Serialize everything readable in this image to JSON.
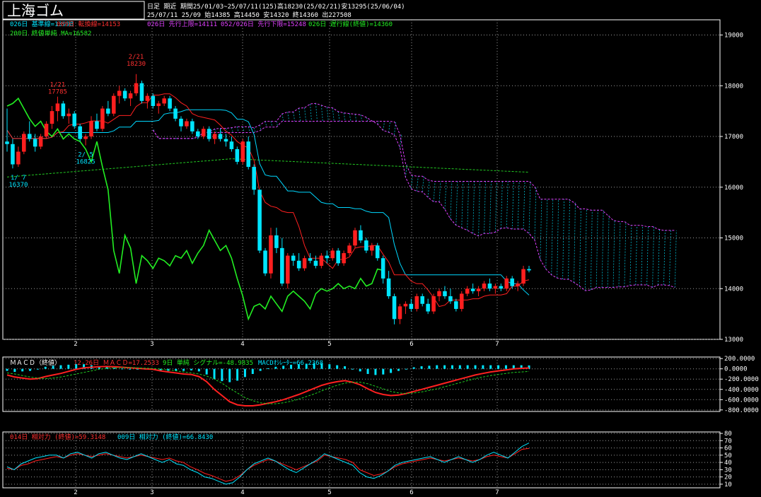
{
  "header": {
    "title": "上海ゴム",
    "line1": "日足  期近  期間25/01/03~25/07/11(125)高18230(25/02/21)安13295(25/06/04)",
    "line2": "25/07/11 25/09 始14385 高14450 安14320 終14360 出227508"
  },
  "colors": {
    "bg": "#000000",
    "axis": "#ffffff",
    "grid": "#9a9a9a",
    "up": "#ff1f1f",
    "down": "#00e5ff",
    "kijun": "#00d8ff",
    "tenkan": "#ff2020",
    "span": "#e040ff",
    "chikou": "#22ee22",
    "ma200": "#22cc22",
    "macd": "#ff2020",
    "signal": "#22cc22",
    "osc": "#00e5ff",
    "rsi": "#ff2020",
    "rsi9": "#00e5ff"
  },
  "price_panel": {
    "legend_row1": [
      {
        "text": "026日 基準線=13998",
        "color": "#00e5ff"
      },
      {
        "text": "009日 転換線=14153",
        "color": "#ff3030"
      },
      {
        "text": "026日 先行上限=14111",
        "color": "#e040ff"
      },
      {
        "text": "052/026日 先行下限=15248",
        "color": "#e040ff"
      },
      {
        "text": "026日 遅行線(終値)=14360",
        "color": "#22ee22"
      }
    ],
    "legend_row2": [
      {
        "text": "200日 終値単純 MA=16582",
        "color": "#22ee22"
      }
    ],
    "annotations": [
      {
        "date_label": "1/ 7",
        "value_label": "16370",
        "color": "#00e5ff"
      },
      {
        "date_label": "1/21",
        "value_label": "17785",
        "color": "#ff3030"
      },
      {
        "date_label": "2/ 5",
        "value_label": "16825",
        "color": "#00e5ff"
      },
      {
        "date_label": "2/21",
        "value_label": "18230",
        "color": "#ff3030"
      }
    ]
  },
  "macd_panel": {
    "legend": [
      {
        "text": "ＭＡＣＤ（終値）",
        "color": "#ffffff"
      },
      {
        "text": "12-26日 ＭＡＣＤ=17.2533",
        "color": "#ff3030"
      },
      {
        "text": "9日 単純 シグナル=-48.9835",
        "color": "#22ee22"
      },
      {
        "text": "MACDｵｼﾚｰﾀｰ=66.2368",
        "color": "#00e5ff"
      }
    ]
  },
  "rsi_panel": {
    "legend": [
      {
        "text": "014日 相対力 (終値)=59.3148",
        "color": "#ff3030"
      },
      {
        "text": "009日 相対力 (終値)=66.8430",
        "color": "#00e5ff"
      }
    ]
  },
  "chart_data": [
    {
      "type": "candlestick",
      "title": "上海ゴム",
      "x_tick_labels": [
        "2",
        "3",
        "4",
        "5",
        "6",
        "7"
      ],
      "y_tick_labels": [
        "13000",
        "14000",
        "15000",
        "16000",
        "17000",
        "18000",
        "19000"
      ],
      "ylim": [
        13000,
        19300
      ],
      "grid": true,
      "candles_ohlc": [
        [
          16900,
          17550,
          16700,
          16850
        ],
        [
          16850,
          16950,
          16370,
          16450
        ],
        [
          16450,
          16800,
          16400,
          16700
        ],
        [
          16700,
          17100,
          16650,
          17050
        ],
        [
          17050,
          17300,
          16900,
          16950
        ],
        [
          16950,
          17050,
          16700,
          16800
        ],
        [
          16800,
          17050,
          16750,
          17000
        ],
        [
          17000,
          17300,
          16950,
          17250
        ],
        [
          17250,
          17600,
          17150,
          17500
        ],
        [
          17500,
          17785,
          17300,
          17650
        ],
        [
          17650,
          17700,
          17350,
          17400
        ],
        [
          17400,
          17550,
          17250,
          17450
        ],
        [
          17450,
          17500,
          17150,
          17200
        ],
        [
          17200,
          17250,
          16900,
          16950
        ],
        [
          16950,
          17050,
          16825,
          17000
        ],
        [
          17000,
          17400,
          16950,
          17300
        ],
        [
          17300,
          17450,
          17100,
          17150
        ],
        [
          17150,
          17600,
          17100,
          17550
        ],
        [
          17550,
          17700,
          17400,
          17450
        ],
        [
          17450,
          17850,
          17400,
          17800
        ],
        [
          17800,
          18000,
          17650,
          17900
        ],
        [
          17900,
          17950,
          17700,
          17750
        ],
        [
          17750,
          17900,
          17600,
          17850
        ],
        [
          17850,
          18230,
          17800,
          18050
        ],
        [
          18050,
          18100,
          17650,
          17700
        ],
        [
          17700,
          17850,
          17550,
          17800
        ],
        [
          17800,
          17850,
          17550,
          17600
        ],
        [
          17600,
          17700,
          17450,
          17650
        ],
        [
          17650,
          17800,
          17600,
          17750
        ],
        [
          17750,
          17800,
          17500,
          17550
        ],
        [
          17550,
          17600,
          17300,
          17350
        ],
        [
          17350,
          17400,
          17100,
          17200
        ],
        [
          17200,
          17350,
          17150,
          17300
        ],
        [
          17300,
          17350,
          17050,
          17100
        ],
        [
          17100,
          17150,
          16950,
          17000
        ],
        [
          17000,
          17200,
          16950,
          17150
        ],
        [
          17150,
          17200,
          16900,
          16950
        ],
        [
          16950,
          17100,
          16850,
          17050
        ],
        [
          17050,
          17150,
          16900,
          16950
        ],
        [
          16950,
          17050,
          16800,
          16900
        ],
        [
          16900,
          17000,
          16700,
          16750
        ],
        [
          16750,
          16800,
          16450,
          16500
        ],
        [
          16500,
          16950,
          16450,
          16900
        ],
        [
          16900,
          17000,
          16350,
          16400
        ],
        [
          16400,
          16450,
          15850,
          15950
        ],
        [
          15950,
          15700,
          14700,
          14750
        ],
        [
          14750,
          14800,
          14250,
          14300
        ],
        [
          14300,
          15200,
          14200,
          15050
        ],
        [
          15050,
          15200,
          14700,
          14800
        ],
        [
          14800,
          15000,
          14050,
          14100
        ],
        [
          14100,
          14700,
          14000,
          14650
        ],
        [
          14650,
          14700,
          14450,
          14550
        ],
        [
          14550,
          14700,
          14350,
          14400
        ],
        [
          14400,
          14650,
          14350,
          14600
        ],
        [
          14600,
          14700,
          14500,
          14550
        ],
        [
          14550,
          14650,
          14400,
          14450
        ],
        [
          14450,
          14700,
          14400,
          14650
        ],
        [
          14650,
          14750,
          14500,
          14600
        ],
        [
          14600,
          14800,
          14550,
          14750
        ],
        [
          14750,
          14800,
          14450,
          14500
        ],
        [
          14500,
          14750,
          14450,
          14700
        ],
        [
          14700,
          14900,
          14650,
          14850
        ],
        [
          14850,
          15200,
          14800,
          15150
        ],
        [
          15150,
          15250,
          14900,
          14950
        ],
        [
          14950,
          15000,
          14700,
          14750
        ],
        [
          14750,
          14900,
          14650,
          14850
        ],
        [
          14850,
          14900,
          14550,
          14600
        ],
        [
          14600,
          14650,
          14100,
          14200
        ],
        [
          14200,
          14350,
          13800,
          13850
        ],
        [
          13850,
          13900,
          13295,
          13400
        ],
        [
          13400,
          13700,
          13300,
          13650
        ],
        [
          13650,
          13750,
          13500,
          13700
        ],
        [
          13700,
          13800,
          13550,
          13600
        ],
        [
          13600,
          13900,
          13550,
          13850
        ],
        [
          13850,
          13900,
          13650,
          13700
        ],
        [
          13700,
          13800,
          13500,
          13550
        ],
        [
          13550,
          13900,
          13500,
          13850
        ],
        [
          13850,
          14000,
          13750,
          13950
        ],
        [
          13950,
          14050,
          13800,
          13850
        ],
        [
          13850,
          14000,
          13700,
          13750
        ],
        [
          13750,
          13800,
          13550,
          13600
        ],
        [
          13600,
          13950,
          13550,
          13900
        ],
        [
          13900,
          14050,
          13850,
          14000
        ],
        [
          14000,
          14100,
          13900,
          13950
        ],
        [
          13950,
          14050,
          13850,
          14000
        ],
        [
          14000,
          14150,
          13950,
          14100
        ],
        [
          14100,
          14200,
          13950,
          14000
        ],
        [
          14000,
          14100,
          13900,
          14050
        ],
        [
          14050,
          14100,
          13950,
          14000
        ],
        [
          14000,
          14250,
          13950,
          14200
        ],
        [
          14200,
          14250,
          14000,
          14050
        ],
        [
          14050,
          14150,
          13950,
          14100
        ],
        [
          14100,
          14450,
          14050,
          14385
        ],
        [
          14385,
          14450,
          14320,
          14360
        ]
      ]
    },
    {
      "type": "line",
      "title": "ＭＡＣＤ（終値）",
      "y_tick_labels": [
        "200.0000",
        "0.0000",
        "-200.0000",
        "-400.0000",
        "-600.0000",
        "-800.0000"
      ],
      "ylim": [
        -830,
        230
      ],
      "series": [
        {
          "name": "12-26日 ＭＡＣＤ",
          "values": [
            -120,
            -160,
            -180,
            -200,
            -190,
            -150,
            -120,
            -90,
            -50,
            -10,
            20,
            30,
            40,
            45,
            40,
            30,
            20,
            10,
            0,
            -10,
            -40,
            -60,
            -80,
            -100,
            -110,
            -150,
            -250,
            -400,
            -520,
            -640,
            -700,
            -720,
            -720,
            -700,
            -670,
            -640,
            -600,
            -550,
            -500,
            -440,
            -380,
            -320,
            -280,
            -250,
            -230,
            -260,
            -310,
            -390,
            -460,
            -500,
            -520,
            -510,
            -480,
            -440,
            -400,
            -360,
            -320,
            -280,
            -240,
            -200,
            -160,
            -120,
            -90,
            -60,
            -40,
            -20,
            0,
            10,
            17.25
          ]
        },
        {
          "name": "9日 単純 シグナル",
          "values": [
            -80,
            -100,
            -130,
            -160,
            -180,
            -190,
            -180,
            -160,
            -130,
            -100,
            -70,
            -40,
            -10,
            10,
            20,
            25,
            25,
            20,
            12,
            5,
            -5,
            -20,
            -40,
            -60,
            -80,
            -100,
            -140,
            -200,
            -280,
            -380,
            -470,
            -560,
            -620,
            -660,
            -680,
            -680,
            -660,
            -630,
            -590,
            -540,
            -490,
            -430,
            -370,
            -320,
            -280,
            -260,
            -260,
            -290,
            -340,
            -390,
            -440,
            -470,
            -480,
            -470,
            -450,
            -420,
            -390,
            -350,
            -310,
            -270,
            -230,
            -190,
            -160,
            -130,
            -110,
            -90,
            -70,
            -60,
            -48.98
          ]
        }
      ],
      "oscillator": {
        "name": "MACDｵｼﾚｰﾀｰ",
        "values": [
          -40,
          -60,
          -50,
          -40,
          -10,
          40,
          60,
          70,
          80,
          90,
          90,
          70,
          50,
          35,
          20,
          5,
          -5,
          -10,
          -12,
          -15,
          -35,
          -40,
          -40,
          -40,
          -30,
          -50,
          -110,
          -200,
          -240,
          -260,
          -230,
          -160,
          -100,
          -40,
          10,
          40,
          60,
          80,
          90,
          100,
          110,
          110,
          90,
          70,
          50,
          0,
          -50,
          -100,
          -120,
          -110,
          -80,
          -40,
          0,
          30,
          50,
          60,
          70,
          70,
          70,
          70,
          70,
          70,
          70,
          70,
          70,
          70,
          70,
          70,
          66.24
        ]
      }
    },
    {
      "type": "line",
      "title": "相対力",
      "y_tick_labels": [
        "80",
        "70",
        "60",
        "50",
        "40",
        "30",
        "20",
        "10"
      ],
      "ylim": [
        5,
        82
      ],
      "series": [
        {
          "name": "014日 相対力 (終値)",
          "values": [
            32,
            30,
            36,
            38,
            42,
            44,
            46,
            48,
            46,
            50,
            52,
            50,
            48,
            50,
            52,
            50,
            48,
            46,
            48,
            50,
            48,
            46,
            44,
            46,
            42,
            40,
            34,
            30,
            25,
            22,
            18,
            14,
            16,
            22,
            30,
            36,
            40,
            44,
            42,
            38,
            34,
            30,
            34,
            38,
            42,
            50,
            48,
            46,
            44,
            40,
            30,
            26,
            22,
            24,
            28,
            34,
            38,
            40,
            42,
            44,
            46,
            44,
            42,
            44,
            46,
            44,
            42,
            44,
            48,
            50,
            48,
            46,
            52,
            58,
            59.31
          ]
        },
        {
          "name": "009日 相対力 (終値)",
          "values": [
            34,
            30,
            38,
            42,
            46,
            48,
            50,
            50,
            46,
            52,
            54,
            50,
            46,
            52,
            54,
            50,
            46,
            44,
            48,
            52,
            48,
            44,
            40,
            44,
            38,
            36,
            30,
            26,
            20,
            18,
            14,
            10,
            12,
            20,
            30,
            38,
            42,
            46,
            42,
            36,
            30,
            26,
            32,
            38,
            44,
            52,
            48,
            44,
            40,
            36,
            26,
            20,
            18,
            22,
            28,
            36,
            40,
            42,
            44,
            46,
            48,
            44,
            40,
            44,
            48,
            44,
            40,
            44,
            50,
            54,
            50,
            46,
            54,
            62,
            66.84
          ]
        }
      ]
    }
  ]
}
